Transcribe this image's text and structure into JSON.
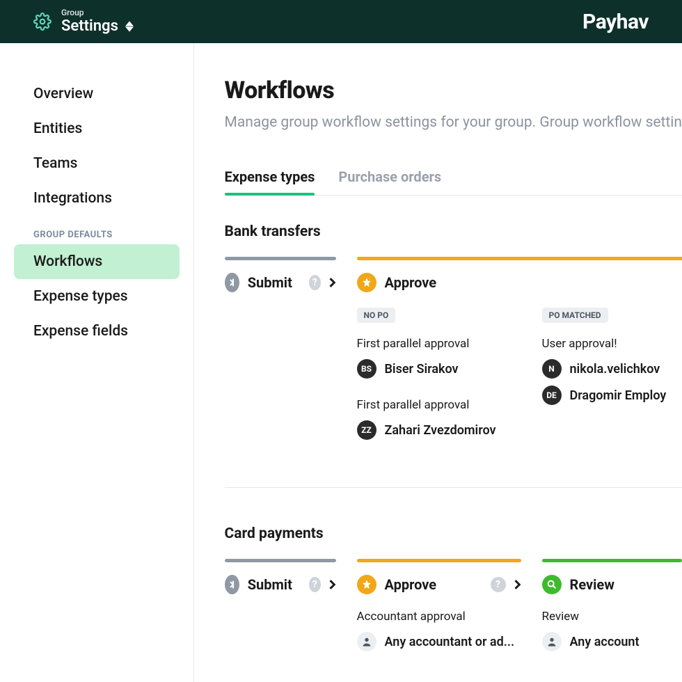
{
  "header": {
    "eyebrow": "Group",
    "title": "Settings",
    "brand": "Payhav"
  },
  "sidebar": {
    "items": [
      {
        "label": "Overview",
        "active": false
      },
      {
        "label": "Entities",
        "active": false
      },
      {
        "label": "Teams",
        "active": false
      },
      {
        "label": "Integrations",
        "active": false
      }
    ],
    "section_label": "GROUP DEFAULTS",
    "default_items": [
      {
        "label": "Workflows",
        "active": true
      },
      {
        "label": "Expense types",
        "active": false
      },
      {
        "label": "Expense fields",
        "active": false
      }
    ]
  },
  "page": {
    "title": "Workflows",
    "description": "Manage group workflow settings for your group. Group workflow settin"
  },
  "tabs": [
    {
      "label": "Expense types",
      "active": true
    },
    {
      "label": "Purchase orders",
      "active": false
    }
  ],
  "bank_transfers": {
    "title": "Bank transfers",
    "stages": {
      "submit": {
        "label": "Submit"
      },
      "approve": {
        "label": "Approve",
        "left": {
          "tag": "NO PO",
          "heading1": "First parallel approval",
          "user1": {
            "initials": "BS",
            "name": "Biser Sirakov"
          },
          "heading2": "First parallel approval",
          "user2": {
            "initials": "ZZ",
            "name": "Zahari Zvezdomirov"
          }
        },
        "right": {
          "tag": "PO MATCHED",
          "heading": "User approval!",
          "user1": {
            "initials": "N",
            "name": "nikola.velichkov"
          },
          "user2": {
            "initials": "DE",
            "name": "Dragomir Employ"
          }
        }
      }
    }
  },
  "card_payments": {
    "title": "Card payments",
    "stages": {
      "submit": {
        "label": "Submit"
      },
      "approve": {
        "label": "Approve",
        "heading": "Accountant approval",
        "user": "Any accountant or ad..."
      },
      "review": {
        "label": "Review",
        "heading": "Review",
        "user": "Any account"
      }
    }
  }
}
